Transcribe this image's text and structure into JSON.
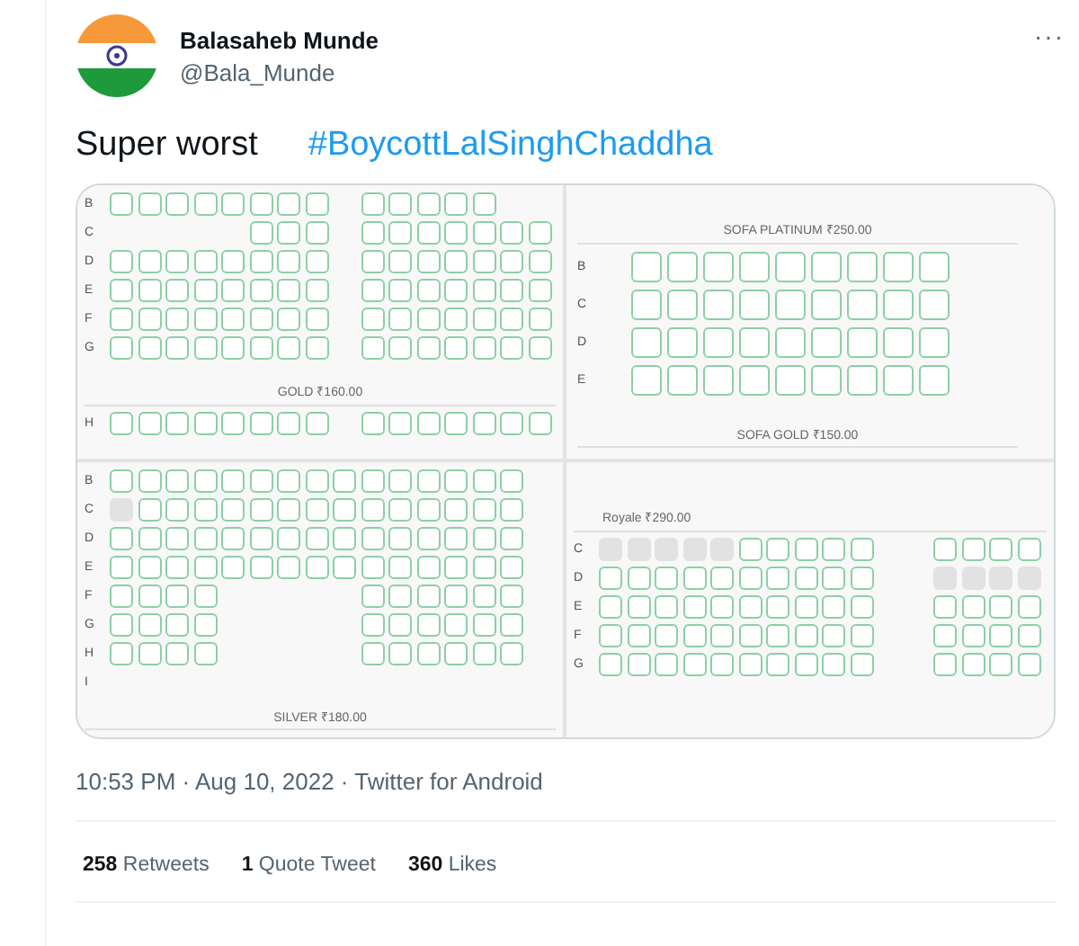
{
  "tweet": {
    "author": {
      "name": "Balasaheb Munde",
      "handle": "@Bala_Munde"
    },
    "more": "···",
    "text": "Super worst",
    "hashtag": "#BoycottLalSinghChaddha",
    "image": {
      "sections": [
        {
          "kind": "standard",
          "items": [
            {
              "kind": "row",
              "label": "B",
              "seats": [
                {
                  "kind": "open"
                },
                {
                  "kind": "open"
                },
                {
                  "kind": "open"
                },
                {
                  "kind": "open"
                },
                {
                  "kind": "open"
                },
                {
                  "kind": "open"
                },
                {
                  "kind": "open"
                },
                {
                  "kind": "open"
                },
                {
                  "kind": "gap"
                },
                {
                  "kind": "open"
                },
                {
                  "kind": "open"
                },
                {
                  "kind": "open"
                },
                {
                  "kind": "open"
                },
                {
                  "kind": "open"
                }
              ]
            },
            {
              "kind": "row",
              "label": "C",
              "seats": [
                {
                  "kind": "gap"
                },
                {
                  "kind": "gap"
                },
                {
                  "kind": "gap"
                },
                {
                  "kind": "gap"
                },
                {
                  "kind": "gap"
                },
                {
                  "kind": "open"
                },
                {
                  "kind": "open"
                },
                {
                  "kind": "open"
                },
                {
                  "kind": "gap"
                },
                {
                  "kind": "open"
                },
                {
                  "kind": "open"
                },
                {
                  "kind": "open"
                },
                {
                  "kind": "open"
                },
                {
                  "kind": "open"
                },
                {
                  "kind": "open"
                },
                {
                  "kind": "open"
                }
              ]
            },
            {
              "kind": "row",
              "label": "D",
              "seats": [
                {
                  "kind": "open"
                },
                {
                  "kind": "open"
                },
                {
                  "kind": "open"
                },
                {
                  "kind": "open"
                },
                {
                  "kind": "open"
                },
                {
                  "kind": "open"
                },
                {
                  "kind": "open"
                },
                {
                  "kind": "open"
                },
                {
                  "kind": "gap"
                },
                {
                  "kind": "open"
                },
                {
                  "kind": "open"
                },
                {
                  "kind": "open"
                },
                {
                  "kind": "open"
                },
                {
                  "kind": "open"
                },
                {
                  "kind": "open"
                },
                {
                  "kind": "open"
                }
              ]
            },
            {
              "kind": "row",
              "label": "E",
              "seats": [
                {
                  "kind": "open"
                },
                {
                  "kind": "open"
                },
                {
                  "kind": "open"
                },
                {
                  "kind": "open"
                },
                {
                  "kind": "open"
                },
                {
                  "kind": "open"
                },
                {
                  "kind": "open"
                },
                {
                  "kind": "open"
                },
                {
                  "kind": "gap"
                },
                {
                  "kind": "open"
                },
                {
                  "kind": "open"
                },
                {
                  "kind": "open"
                },
                {
                  "kind": "open"
                },
                {
                  "kind": "open"
                },
                {
                  "kind": "open"
                },
                {
                  "kind": "open"
                }
              ]
            },
            {
              "kind": "row",
              "label": "F",
              "seats": [
                {
                  "kind": "open"
                },
                {
                  "kind": "open"
                },
                {
                  "kind": "open"
                },
                {
                  "kind": "open"
                },
                {
                  "kind": "open"
                },
                {
                  "kind": "open"
                },
                {
                  "kind": "open"
                },
                {
                  "kind": "open"
                },
                {
                  "kind": "gap"
                },
                {
                  "kind": "open"
                },
                {
                  "kind": "open"
                },
                {
                  "kind": "open"
                },
                {
                  "kind": "open"
                },
                {
                  "kind": "open"
                },
                {
                  "kind": "open"
                },
                {
                  "kind": "open"
                }
              ]
            },
            {
              "kind": "row",
              "label": "G",
              "seats": [
                {
                  "kind": "open"
                },
                {
                  "kind": "open"
                },
                {
                  "kind": "open"
                },
                {
                  "kind": "open"
                },
                {
                  "kind": "open"
                },
                {
                  "kind": "open"
                },
                {
                  "kind": "open"
                },
                {
                  "kind": "open"
                },
                {
                  "kind": "gap"
                },
                {
                  "kind": "open"
                },
                {
                  "kind": "open"
                },
                {
                  "kind": "open"
                },
                {
                  "kind": "open"
                },
                {
                  "kind": "open"
                },
                {
                  "kind": "open"
                },
                {
                  "kind": "open"
                }
              ]
            },
            {
              "kind": "heading",
              "text": "GOLD ₹160.00"
            },
            {
              "kind": "row",
              "label": "H",
              "seats": [
                {
                  "kind": "open"
                },
                {
                  "kind": "open"
                },
                {
                  "kind": "open"
                },
                {
                  "kind": "open"
                },
                {
                  "kind": "open"
                },
                {
                  "kind": "open"
                },
                {
                  "kind": "open"
                },
                {
                  "kind": "open"
                },
                {
                  "kind": "gap"
                },
                {
                  "kind": "open"
                },
                {
                  "kind": "open"
                },
                {
                  "kind": "open"
                },
                {
                  "kind": "open"
                },
                {
                  "kind": "open"
                },
                {
                  "kind": "open"
                },
                {
                  "kind": "open"
                }
              ]
            }
          ]
        },
        {
          "kind": "sofa",
          "items": [
            {
              "kind": "heading",
              "text": "SOFA PLATINUM ₹250.00"
            },
            {
              "kind": "row",
              "label": "B",
              "seats": [
                {
                  "kind": "open"
                },
                {
                  "kind": "open"
                },
                {
                  "kind": "open"
                },
                {
                  "kind": "open"
                },
                {
                  "kind": "open"
                },
                {
                  "kind": "open"
                },
                {
                  "kind": "open"
                },
                {
                  "kind": "open"
                },
                {
                  "kind": "open"
                }
              ]
            },
            {
              "kind": "row",
              "label": "C",
              "seats": [
                {
                  "kind": "open"
                },
                {
                  "kind": "open"
                },
                {
                  "kind": "open"
                },
                {
                  "kind": "open"
                },
                {
                  "kind": "open"
                },
                {
                  "kind": "open"
                },
                {
                  "kind": "open"
                },
                {
                  "kind": "open"
                },
                {
                  "kind": "open"
                }
              ]
            },
            {
              "kind": "row",
              "label": "D",
              "seats": [
                {
                  "kind": "open"
                },
                {
                  "kind": "open"
                },
                {
                  "kind": "open"
                },
                {
                  "kind": "open"
                },
                {
                  "kind": "open"
                },
                {
                  "kind": "open"
                },
                {
                  "kind": "open"
                },
                {
                  "kind": "open"
                },
                {
                  "kind": "open"
                }
              ]
            },
            {
              "kind": "row",
              "label": "E",
              "seats": [
                {
                  "kind": "open"
                },
                {
                  "kind": "open"
                },
                {
                  "kind": "open"
                },
                {
                  "kind": "open"
                },
                {
                  "kind": "open"
                },
                {
                  "kind": "open"
                },
                {
                  "kind": "open"
                },
                {
                  "kind": "open"
                },
                {
                  "kind": "open"
                }
              ]
            },
            {
              "kind": "heading",
              "text": "SOFA GOLD ₹150.00"
            }
          ]
        },
        {
          "kind": "standard",
          "items": [
            {
              "kind": "row",
              "label": "B",
              "seats": [
                {
                  "kind": "open"
                },
                {
                  "kind": "open"
                },
                {
                  "kind": "open"
                },
                {
                  "kind": "open"
                },
                {
                  "kind": "open"
                },
                {
                  "kind": "open"
                },
                {
                  "kind": "open"
                },
                {
                  "kind": "open"
                },
                {
                  "kind": "open"
                },
                {
                  "kind": "open"
                },
                {
                  "kind": "open"
                },
                {
                  "kind": "open"
                },
                {
                  "kind": "open"
                },
                {
                  "kind": "open"
                },
                {
                  "kind": "open"
                }
              ]
            },
            {
              "kind": "row",
              "label": "C",
              "seats": [
                {
                  "kind": "sold"
                },
                {
                  "kind": "open"
                },
                {
                  "kind": "open"
                },
                {
                  "kind": "open"
                },
                {
                  "kind": "open"
                },
                {
                  "kind": "open"
                },
                {
                  "kind": "open"
                },
                {
                  "kind": "open"
                },
                {
                  "kind": "open"
                },
                {
                  "kind": "open"
                },
                {
                  "kind": "open"
                },
                {
                  "kind": "open"
                },
                {
                  "kind": "open"
                },
                {
                  "kind": "open"
                },
                {
                  "kind": "open"
                }
              ]
            },
            {
              "kind": "row",
              "label": "D",
              "seats": [
                {
                  "kind": "open"
                },
                {
                  "kind": "open"
                },
                {
                  "kind": "open"
                },
                {
                  "kind": "open"
                },
                {
                  "kind": "open"
                },
                {
                  "kind": "open"
                },
                {
                  "kind": "open"
                },
                {
                  "kind": "open"
                },
                {
                  "kind": "open"
                },
                {
                  "kind": "open"
                },
                {
                  "kind": "open"
                },
                {
                  "kind": "open"
                },
                {
                  "kind": "open"
                },
                {
                  "kind": "open"
                },
                {
                  "kind": "open"
                }
              ]
            },
            {
              "kind": "row",
              "label": "E",
              "seats": [
                {
                  "kind": "open"
                },
                {
                  "kind": "open"
                },
                {
                  "kind": "open"
                },
                {
                  "kind": "open"
                },
                {
                  "kind": "open"
                },
                {
                  "kind": "open"
                },
                {
                  "kind": "open"
                },
                {
                  "kind": "open"
                },
                {
                  "kind": "open"
                },
                {
                  "kind": "open"
                },
                {
                  "kind": "open"
                },
                {
                  "kind": "open"
                },
                {
                  "kind": "open"
                },
                {
                  "kind": "open"
                },
                {
                  "kind": "open"
                }
              ]
            },
            {
              "kind": "row",
              "label": "F",
              "seats": [
                {
                  "kind": "open"
                },
                {
                  "kind": "open"
                },
                {
                  "kind": "open"
                },
                {
                  "kind": "open"
                },
                {
                  "kind": "gap"
                },
                {
                  "kind": "gap"
                },
                {
                  "kind": "gap"
                },
                {
                  "kind": "gap"
                },
                {
                  "kind": "gap"
                },
                {
                  "kind": "open"
                },
                {
                  "kind": "open"
                },
                {
                  "kind": "open"
                },
                {
                  "kind": "open"
                },
                {
                  "kind": "open"
                },
                {
                  "kind": "open"
                }
              ]
            },
            {
              "kind": "row",
              "label": "G",
              "seats": [
                {
                  "kind": "open"
                },
                {
                  "kind": "open"
                },
                {
                  "kind": "open"
                },
                {
                  "kind": "open"
                },
                {
                  "kind": "gap"
                },
                {
                  "kind": "gap"
                },
                {
                  "kind": "gap"
                },
                {
                  "kind": "gap"
                },
                {
                  "kind": "gap"
                },
                {
                  "kind": "open"
                },
                {
                  "kind": "open"
                },
                {
                  "kind": "open"
                },
                {
                  "kind": "open"
                },
                {
                  "kind": "open"
                },
                {
                  "kind": "open"
                }
              ]
            },
            {
              "kind": "row",
              "label": "H",
              "seats": [
                {
                  "kind": "open"
                },
                {
                  "kind": "open"
                },
                {
                  "kind": "open"
                },
                {
                  "kind": "open"
                },
                {
                  "kind": "gap"
                },
                {
                  "kind": "gap"
                },
                {
                  "kind": "gap"
                },
                {
                  "kind": "gap"
                },
                {
                  "kind": "gap"
                },
                {
                  "kind": "open"
                },
                {
                  "kind": "open"
                },
                {
                  "kind": "open"
                },
                {
                  "kind": "open"
                },
                {
                  "kind": "open"
                },
                {
                  "kind": "open"
                }
              ]
            },
            {
              "kind": "row",
              "label": "I"
            },
            {
              "kind": "heading",
              "text": "SILVER ₹180.00"
            }
          ]
        },
        {
          "kind": "standard",
          "items": [
            {
              "kind": "label",
              "text": "Royale ₹290.00"
            },
            {
              "kind": "row",
              "label": "C",
              "seats": [
                {
                  "kind": "sold"
                },
                {
                  "kind": "sold"
                },
                {
                  "kind": "sold"
                },
                {
                  "kind": "sold"
                },
                {
                  "kind": "sold"
                },
                {
                  "kind": "open"
                },
                {
                  "kind": "open"
                },
                {
                  "kind": "open"
                },
                {
                  "kind": "open"
                },
                {
                  "kind": "open"
                },
                {
                  "kind": "gap"
                },
                {
                  "kind": "gap"
                },
                {
                  "kind": "open"
                },
                {
                  "kind": "open"
                },
                {
                  "kind": "open"
                },
                {
                  "kind": "open"
                }
              ]
            },
            {
              "kind": "row",
              "label": "D",
              "seats": [
                {
                  "kind": "open"
                },
                {
                  "kind": "open"
                },
                {
                  "kind": "open"
                },
                {
                  "kind": "open"
                },
                {
                  "kind": "open"
                },
                {
                  "kind": "open"
                },
                {
                  "kind": "open"
                },
                {
                  "kind": "open"
                },
                {
                  "kind": "open"
                },
                {
                  "kind": "open"
                },
                {
                  "kind": "gap"
                },
                {
                  "kind": "gap"
                },
                {
                  "kind": "sold"
                },
                {
                  "kind": "sold"
                },
                {
                  "kind": "sold"
                },
                {
                  "kind": "sold"
                }
              ]
            },
            {
              "kind": "row",
              "label": "E",
              "seats": [
                {
                  "kind": "open"
                },
                {
                  "kind": "open"
                },
                {
                  "kind": "open"
                },
                {
                  "kind": "open"
                },
                {
                  "kind": "open"
                },
                {
                  "kind": "open"
                },
                {
                  "kind": "open"
                },
                {
                  "kind": "open"
                },
                {
                  "kind": "open"
                },
                {
                  "kind": "open"
                },
                {
                  "kind": "gap"
                },
                {
                  "kind": "gap"
                },
                {
                  "kind": "open"
                },
                {
                  "kind": "open"
                },
                {
                  "kind": "open"
                },
                {
                  "kind": "open"
                }
              ]
            },
            {
              "kind": "row",
              "label": "F",
              "seats": [
                {
                  "kind": "open"
                },
                {
                  "kind": "open"
                },
                {
                  "kind": "open"
                },
                {
                  "kind": "open"
                },
                {
                  "kind": "open"
                },
                {
                  "kind": "open"
                },
                {
                  "kind": "open"
                },
                {
                  "kind": "open"
                },
                {
                  "kind": "open"
                },
                {
                  "kind": "open"
                },
                {
                  "kind": "gap"
                },
                {
                  "kind": "gap"
                },
                {
                  "kind": "open"
                },
                {
                  "kind": "open"
                },
                {
                  "kind": "open"
                },
                {
                  "kind": "open"
                }
              ]
            },
            {
              "kind": "row",
              "label": "G",
              "seats": [
                {
                  "kind": "open"
                },
                {
                  "kind": "open"
                },
                {
                  "kind": "open"
                },
                {
                  "kind": "open"
                },
                {
                  "kind": "open"
                },
                {
                  "kind": "open"
                },
                {
                  "kind": "open"
                },
                {
                  "kind": "open"
                },
                {
                  "kind": "open"
                },
                {
                  "kind": "open"
                },
                {
                  "kind": "gap"
                },
                {
                  "kind": "gap"
                },
                {
                  "kind": "open"
                },
                {
                  "kind": "open"
                },
                {
                  "kind": "open"
                },
                {
                  "kind": "open"
                }
              ]
            }
          ]
        }
      ]
    },
    "meta": "10:53 PM · Aug 10, 2022 · Twitter for Android",
    "stats": [
      "**258** Retweets",
      "**1** Quote Tweet",
      "**360** Likes"
    ]
  }
}
